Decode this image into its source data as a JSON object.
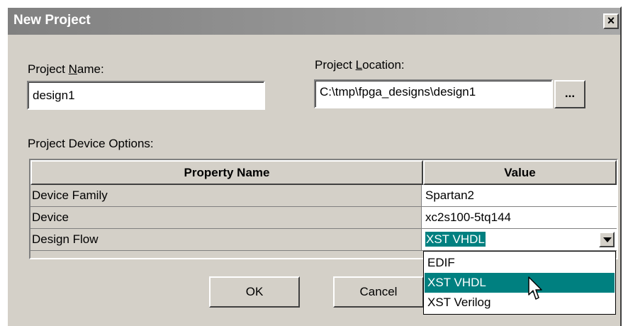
{
  "dialog": {
    "title": "New Project",
    "close_glyph": "×"
  },
  "project_name": {
    "label_pre": "Project ",
    "label_key": "N",
    "label_post": "ame:",
    "value": "design1"
  },
  "project_location": {
    "label_pre": "Project ",
    "label_key": "L",
    "label_post": "ocation:",
    "value": "C:\\tmp\\fpga_designs\\design1",
    "browse_label": "..."
  },
  "device_options": {
    "label": "Project Device Options:",
    "headers": {
      "property": "Property Name",
      "value": "Value"
    },
    "rows": [
      {
        "name": "Device Family",
        "value": "Spartan2"
      },
      {
        "name": "Device",
        "value": "xc2s100-5tq144"
      },
      {
        "name": "Design Flow",
        "value": "XST VHDL"
      }
    ],
    "dropdown_options": [
      "EDIF",
      "XST VHDL",
      "XST Verilog"
    ],
    "highlighted_option": "XST VHDL"
  },
  "buttons": {
    "ok": "OK",
    "cancel": "Cancel"
  },
  "colors": {
    "selection": "#008080",
    "face": "#d4d0c8",
    "title_gradient_start": "#808080"
  },
  "icons": {
    "close": "close-icon",
    "dropdown": "chevron-down-icon",
    "cursor": "mouse-pointer-icon"
  }
}
